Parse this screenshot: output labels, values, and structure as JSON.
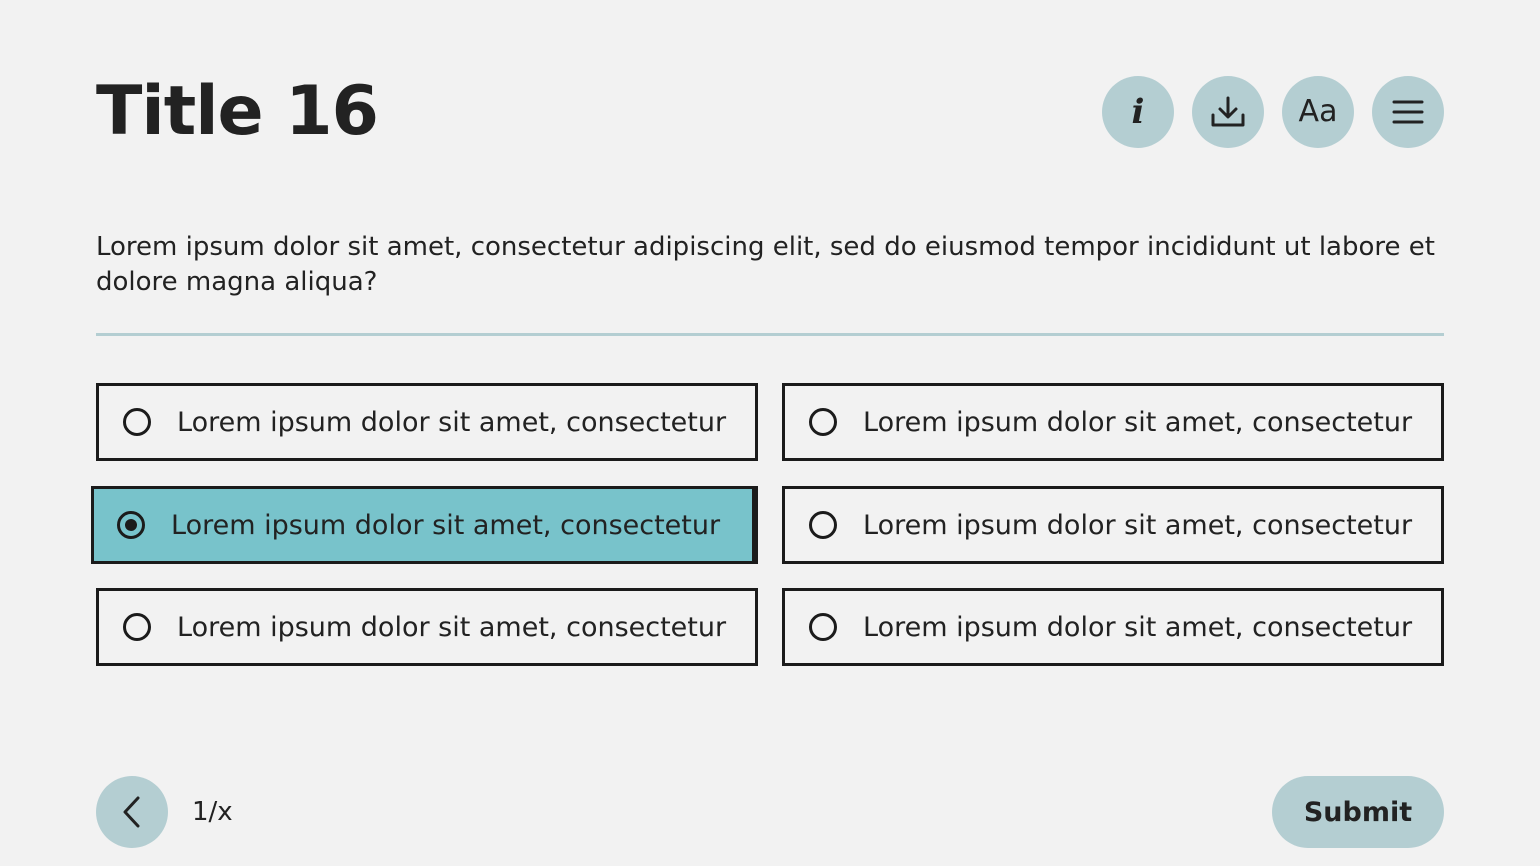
{
  "header": {
    "title": "Title 16",
    "buttons": [
      {
        "icon": "info-icon",
        "glyph": "i"
      },
      {
        "icon": "download-icon"
      },
      {
        "icon": "font-size-icon",
        "glyph": "Aa"
      },
      {
        "icon": "menu-icon"
      }
    ]
  },
  "question": {
    "text": "Lorem ipsum dolor sit amet, consectetur adipiscing elit, sed do eiusmod tempor incididunt ut labore et dolore magna aliqua?"
  },
  "answers": [
    {
      "label": "Lorem ipsum dolor sit amet, consectetur",
      "selected": false
    },
    {
      "label": "Lorem ipsum dolor sit amet, consectetur",
      "selected": false
    },
    {
      "label": "Lorem ipsum dolor sit amet, consectetur",
      "selected": true
    },
    {
      "label": "Lorem ipsum dolor sit amet, consectetur",
      "selected": false
    },
    {
      "label": "Lorem ipsum dolor sit amet, consectetur",
      "selected": false
    },
    {
      "label": "Lorem ipsum dolor sit amet, consectetur",
      "selected": false
    }
  ],
  "footer": {
    "back_icon": "chevron-left-icon",
    "page_indicator": "1/x",
    "submit_label": "Submit"
  },
  "colors": {
    "background": "#f2f2f2",
    "button_fill": "#b4ced2",
    "selected_fill": "#78c3cb",
    "border": "#1b1b1b",
    "text": "#222222"
  }
}
